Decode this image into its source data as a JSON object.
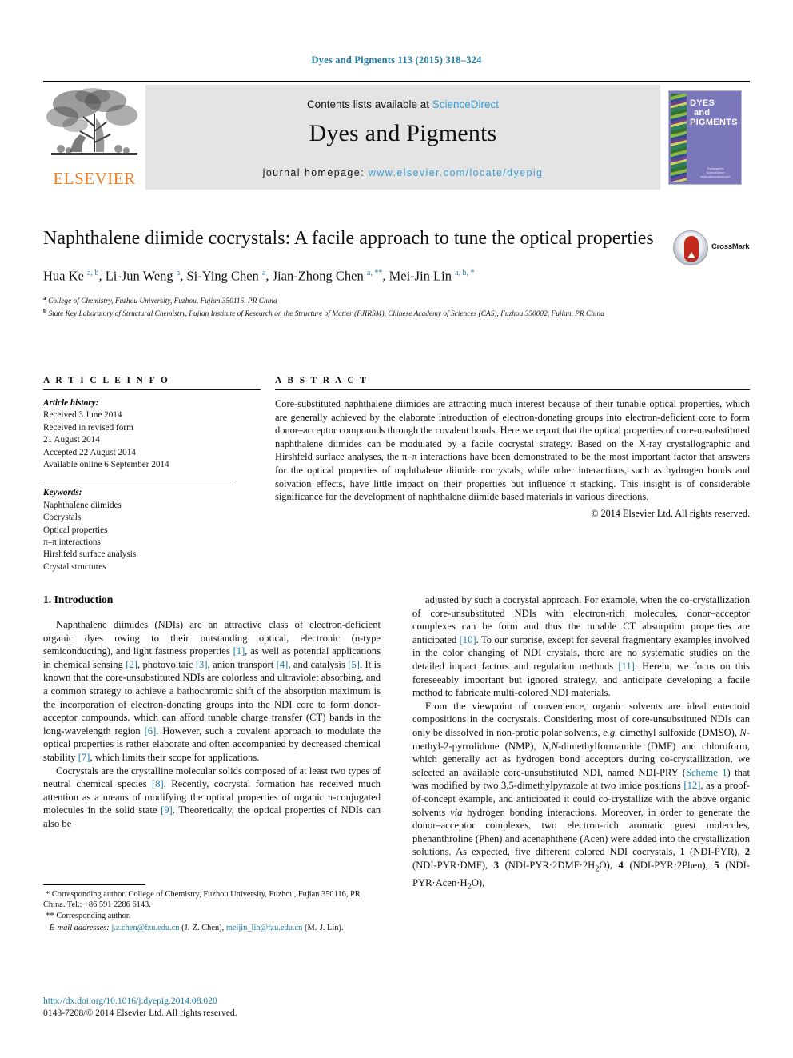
{
  "running_head": "Dyes and Pigments 113 (2015) 318–324",
  "masthead": {
    "publisher_logo_text": "ELSEVIER",
    "contents_prefix": "Contents lists available at ",
    "contents_link": "ScienceDirect",
    "journal_title": "Dyes and Pigments",
    "homepage_prefix": "journal homepage: ",
    "homepage_url": "www.elsevier.com/locate/dyepig",
    "cover": {
      "line1": "DYES",
      "line2": "and",
      "line3": "PIGMENTS",
      "footer1": "Published by",
      "footer2": "ScienceDirect",
      "footer3": "www.sciencedirect.com"
    }
  },
  "article": {
    "title": "Naphthalene diimide cocrystals: A facile approach to tune the optical properties",
    "crossmark_label": "CrossMark",
    "authors_html": "Hua Ke <sup>a, b</sup>, Li-Jun Weng <sup>a</sup>, Si-Ying Chen <sup>a</sup>, Jian-Zhong Chen <sup>a, **</sup>, Mei-Jin Lin <sup>a, b, *</sup>",
    "affiliation_a": "College of Chemistry, Fuzhou University, Fuzhou, Fujian 350116, PR China",
    "affiliation_b": "State Key Laboratory of Structural Chemistry, Fujian Institute of Research on the Structure of Matter (FJIRSM), Chinese Academy of Sciences (CAS), Fuzhou 350002, Fujian, PR China"
  },
  "info": {
    "heading": "A R T I C L E   I N F O",
    "history_label": "Article history:",
    "history": [
      "Received 3 June 2014",
      "Received in revised form",
      "21 August 2014",
      "Accepted 22 August 2014",
      "Available online 6 September 2014"
    ],
    "keywords_label": "Keywords:",
    "keywords": [
      "Naphthalene diimides",
      "Cocrystals",
      "Optical properties",
      "π–π interactions",
      "Hirshfeld surface analysis",
      "Crystal structures"
    ]
  },
  "abstract": {
    "heading": "A B S T R A C T",
    "text": "Core-substituted naphthalene diimides are attracting much interest because of their tunable optical properties, which are generally achieved by the elaborate introduction of electron-donating groups into electron-deficient core to form donor–acceptor compounds through the covalent bonds. Here we report that the optical properties of core-unsubstituted naphthalene diimides can be modulated by a facile cocrystal strategy. Based on the X-ray crystallographic and Hirshfeld surface analyses, the π–π interactions have been demonstrated to be the most important factor that answers for the optical properties of naphthalene diimide cocrystals, while other interactions, such as hydrogen bonds and solvation effects, have little impact on their properties but influence π stacking. This insight is of considerable significance for the development of naphthalene diimide based materials in various directions.",
    "copyright": "© 2014 Elsevier Ltd. All rights reserved."
  },
  "body": {
    "section_title": "1.  Introduction",
    "left_paragraphs": [
      "Naphthalene diimides (NDIs) are an attractive class of electron-deficient organic dyes owing to their outstanding optical, electronic (n-type semiconducting), and light fastness properties <span class=\"ref\">[1]</span>, as well as potential applications in chemical sensing <span class=\"ref\">[2]</span>, photovoltaic <span class=\"ref\">[3]</span>, anion transport <span class=\"ref\">[4]</span>, and catalysis <span class=\"ref\">[5]</span>. It is known that the core-unsubstituted NDIs are colorless and ultraviolet absorbing, and a common strategy to achieve a bathochromic shift of the absorption maximum is the incorporation of electron-donating groups into the NDI core to form donor-acceptor compounds, which can afford tunable charge transfer (CT) bands in the long-wavelength region <span class=\"ref\">[6]</span>. However, such a covalent approach to modulate the optical properties is rather elaborate and often accompanied by decreased chemical stability <span class=\"ref\">[7]</span>, which limits their scope for applications.",
      "Cocrystals are the crystalline molecular solids composed of at least two types of neutral chemical species <span class=\"ref\">[8]</span>. Recently, cocrystal formation has received much attention as a means of modifying the optical properties of organic π-conjugated molecules in the solid state <span class=\"ref\">[9]</span>. Theoretically, the optical properties of NDIs can also be"
    ],
    "right_paragraphs": [
      "adjusted by such a cocrystal approach. For example, when the co-crystallization of core-unsubstituted NDIs with electron-rich molecules, donor–acceptor complexes can be form and thus the tunable CT absorption properties are anticipated <span class=\"ref\">[10]</span>. To our surprise, except for several fragmentary examples involved in the color changing of NDI crystals, there are no systematic studies on the detailed impact factors and regulation methods <span class=\"ref\">[11]</span>. Herein, we focus on this foreseeably important but ignored strategy, and anticipate developing a facile method to fabricate multi-colored NDI materials.",
      "From the viewpoint of convenience, organic solvents are ideal eutectoid compositions in the cocrystals. Considering most of core-unsubstituted NDIs can only be dissolved in non-protic polar solvents, <i>e.g.</i> dimethyl sulfoxide (DMSO), <i>N</i>-methyl-2-pyrrolidone (NMP), <i>N,N</i>-dimethylformamide (DMF) and chloroform, which generally act as hydrogen bond acceptors during co-crystallization, we selected an available core-unsubstituted NDI, named NDI-PRY (<span class=\"blue\">Scheme 1</span>) that was modified by two 3,5-dimethylpyrazole at two imide positions <span class=\"ref\">[12]</span>, as a proof-of-concept example, and anticipated it could co-crystallize with the above organic solvents <i>via</i> hydrogen bonding interactions. Moreover, in order to generate the donor–acceptor complexes, two electron-rich aromatic guest molecules, phenanthroline (Phen) and acenaphthene (Acen) were added into the crystallization solutions. As expected, five different colored NDI cocrystals, <b>1</b> (NDI-PYR), <b>2</b> (NDI-PYR·DMF), <b>3</b> (NDI-PYR·2DMF·2H<sub>2</sub>O), <b>4</b> (NDI-PYR·2Phen), <b>5</b> (NDI-PYR·Acen·H<sub>2</sub>O),"
    ]
  },
  "footnotes": {
    "note1": "Corresponding author. College of Chemistry, Fuzhou University, Fuzhou, Fujian 350116, PR China. Tel.: +86 591 2286 6143.",
    "note2": "Corresponding author.",
    "email_label": "E-mail addresses:",
    "email1": "j.z.chen@fzu.edu.cn",
    "email1_name": "(J.-Z. Chen)",
    "email2": "meijin_lin@fzu.edu.cn",
    "email2_name": "(M.-J. Lin).",
    "doi": "http://dx.doi.org/10.1016/j.dyepig.2014.08.020",
    "issn_line": "0143-7208/© 2014 Elsevier Ltd. All rights reserved."
  },
  "colors": {
    "link": "#1b7ba6",
    "science_direct": "#3a9ed4",
    "elsevier_orange": "#ef7d22",
    "cover_purple": "#7b77bb"
  }
}
